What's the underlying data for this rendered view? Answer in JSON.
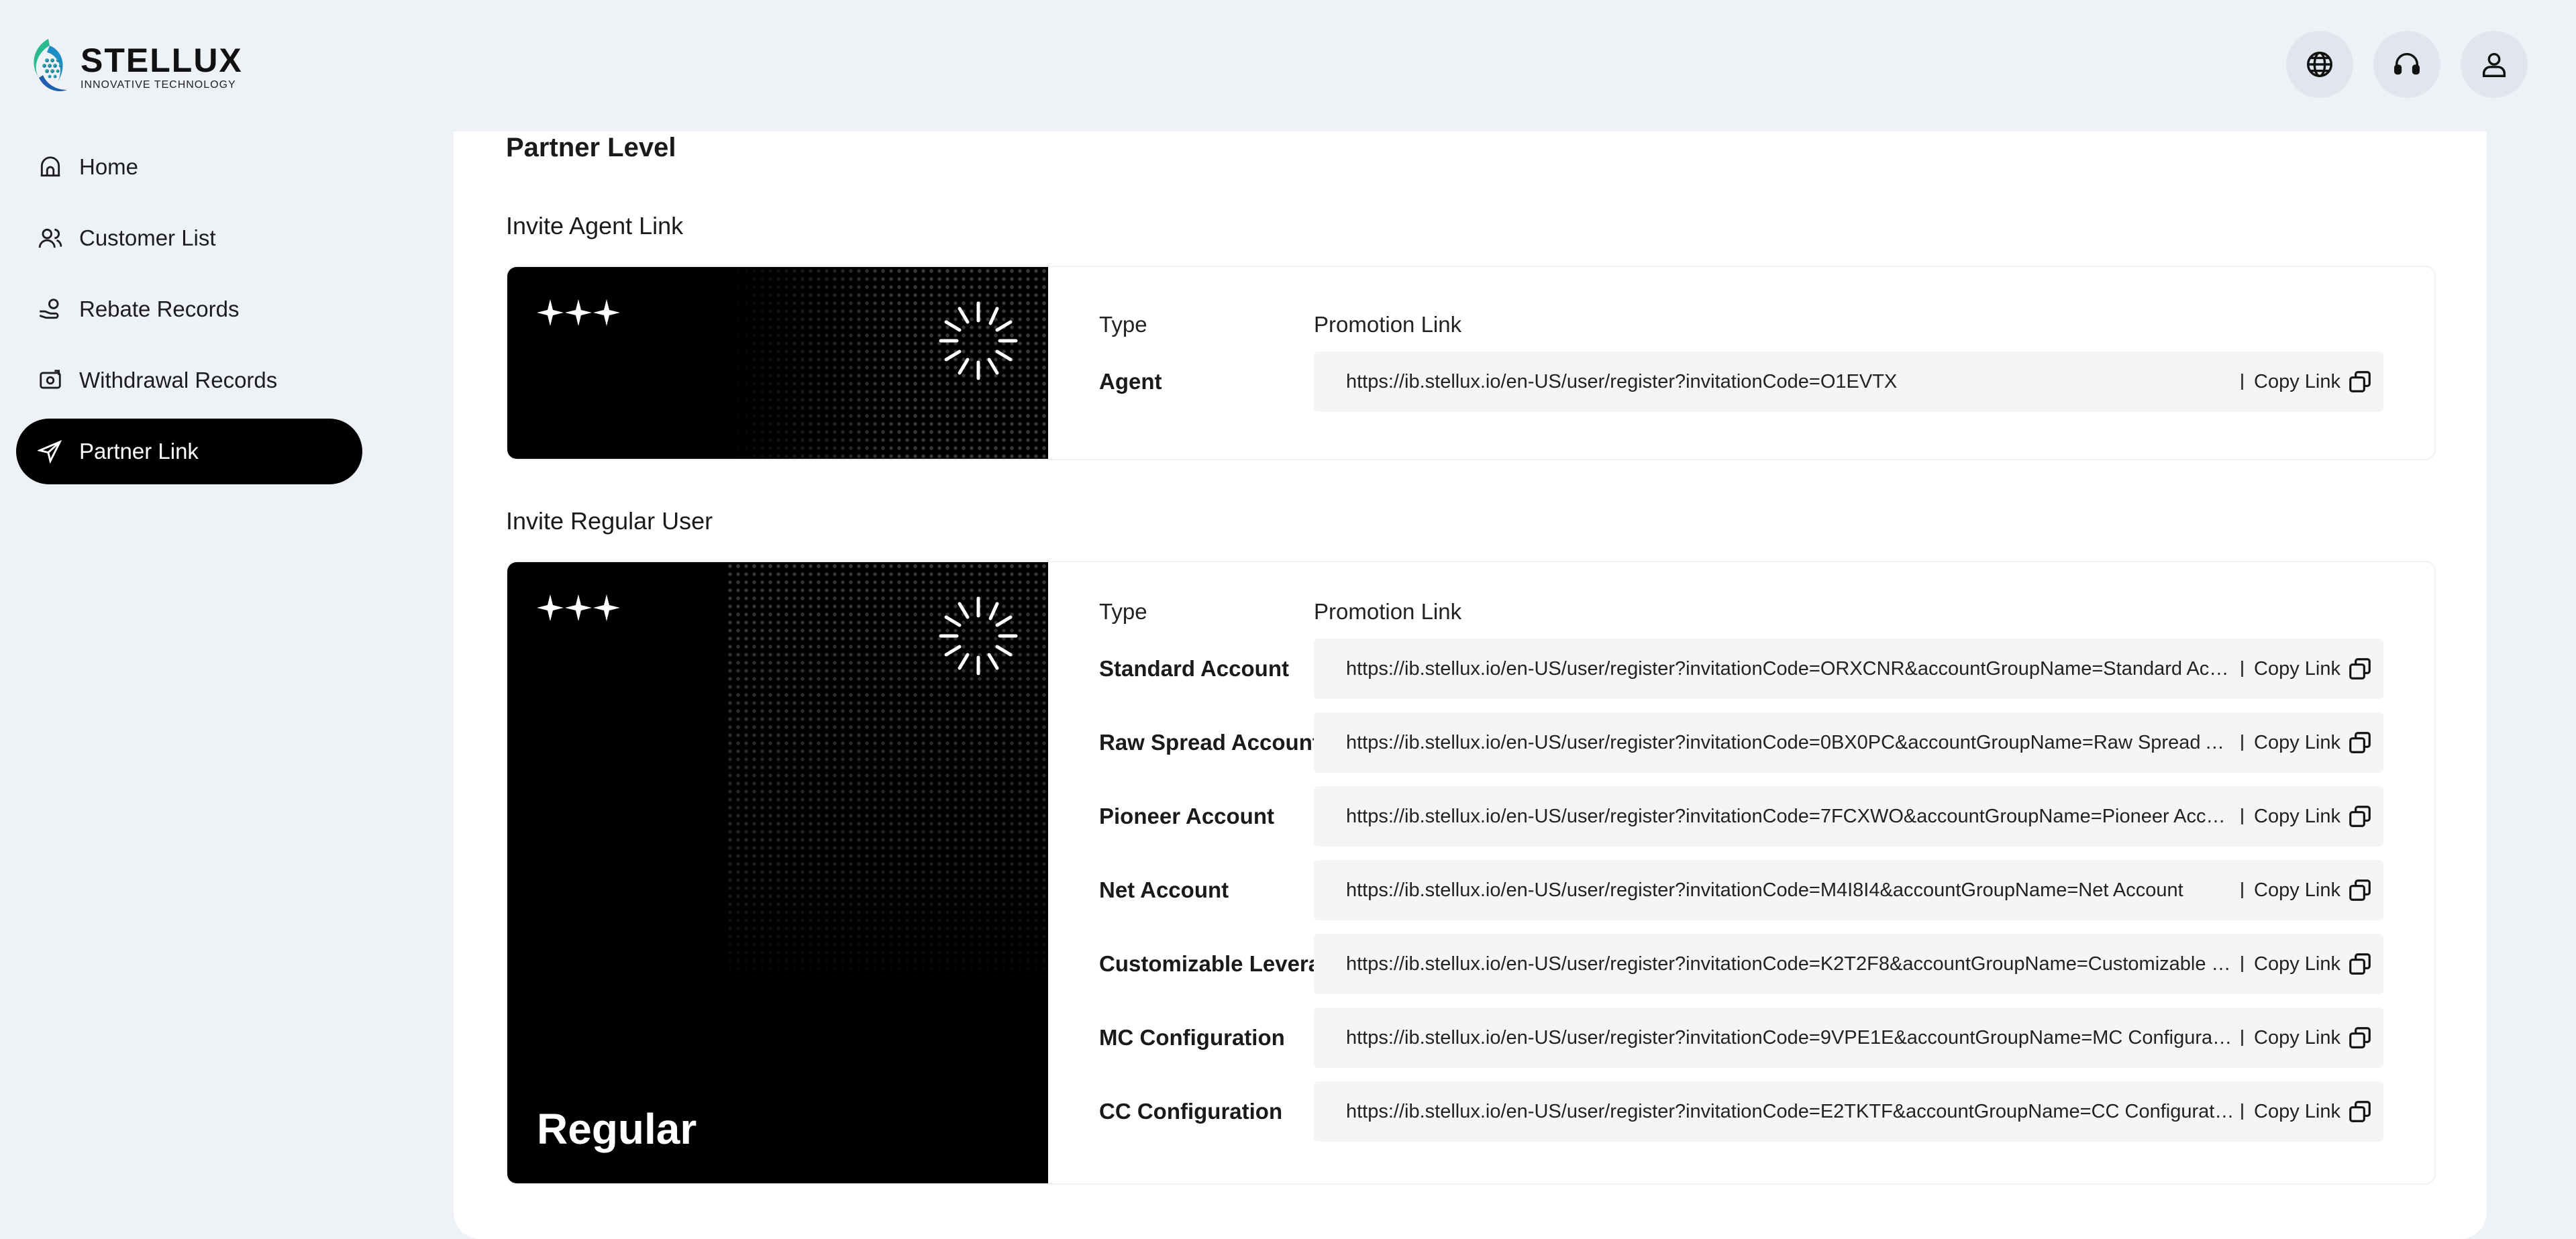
{
  "brand": {
    "name": "STELLUX",
    "tagline": "INNOVATIVE TECHNOLOGY"
  },
  "header": {
    "actions": [
      "globe-icon",
      "headset-icon",
      "user-icon"
    ]
  },
  "sidebar": {
    "items": [
      {
        "label": "Home",
        "icon": "home-icon",
        "active": false
      },
      {
        "label": "Customer List",
        "icon": "users-icon",
        "active": false
      },
      {
        "label": "Rebate Records",
        "icon": "hand-coin-icon",
        "active": false
      },
      {
        "label": "Withdrawal Records",
        "icon": "withdraw-icon",
        "active": false
      },
      {
        "label": "Partner Link",
        "icon": "send-icon",
        "active": true
      }
    ]
  },
  "main": {
    "title": "Partner Level",
    "copy_label": "Copy Link",
    "agent": {
      "section_title": "Invite Agent Link",
      "col_type": "Type",
      "col_link": "Promotion Link",
      "rows": [
        {
          "type": "Agent",
          "url": "https://ib.stellux.io/en-US/user/register?invitationCode=O1EVTX"
        }
      ]
    },
    "regular": {
      "section_title": "Invite Regular User",
      "banner_level": "Regular",
      "col_type": "Type",
      "col_link": "Promotion Link",
      "rows": [
        {
          "type": "Standard Account",
          "url": "https://ib.stellux.io/en-US/user/register?invitationCode=ORXCNR&accountGroupName=Standard Account"
        },
        {
          "type": "Raw Spread Account",
          "url": "https://ib.stellux.io/en-US/user/register?invitationCode=0BX0PC&accountGroupName=Raw Spread Account"
        },
        {
          "type": "Pioneer Account",
          "url": "https://ib.stellux.io/en-US/user/register?invitationCode=7FCXWO&accountGroupName=Pioneer Account"
        },
        {
          "type": "Net Account",
          "url": "https://ib.stellux.io/en-US/user/register?invitationCode=M4I8I4&accountGroupName=Net Account"
        },
        {
          "type": "Customizable Leverage",
          "url": "https://ib.stellux.io/en-US/user/register?invitationCode=K2T2F8&accountGroupName=Customizable Leverage"
        },
        {
          "type": "MC Configuration",
          "url": "https://ib.stellux.io/en-US/user/register?invitationCode=9VPE1E&accountGroupName=MC Configuration"
        },
        {
          "type": "CC Configuration",
          "url": "https://ib.stellux.io/en-US/user/register?invitationCode=E2TKTF&accountGroupName=CC Configuration"
        }
      ]
    }
  }
}
